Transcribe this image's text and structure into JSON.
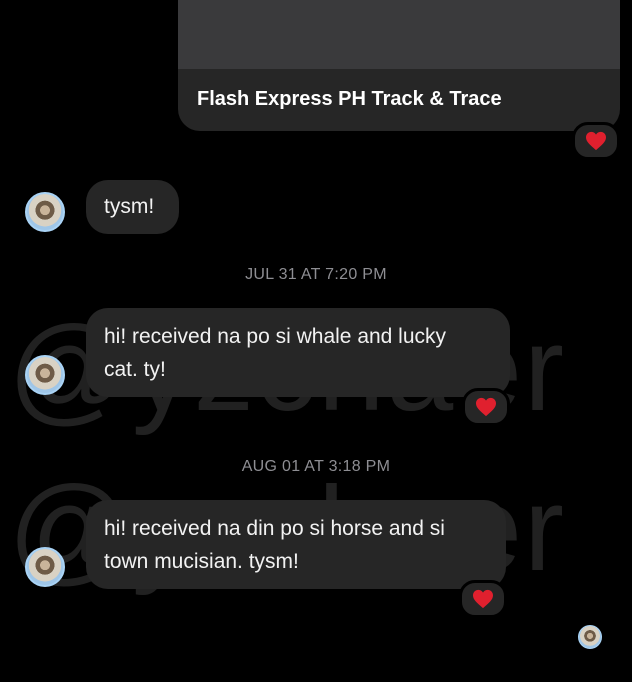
{
  "link_card": {
    "title": "Flash Express PH Track & Trace"
  },
  "reactions": {
    "emoji": "❤️",
    "color": "#e0202e"
  },
  "messages": [
    {
      "text": "tysm!"
    },
    {
      "timestamp": "JUL 31 AT 7:20 PM",
      "line1": "hi! received na po si whale and lucky",
      "line2": "cat. ty!"
    },
    {
      "timestamp": "AUG 01 AT 3:18 PM",
      "line1": "hi! received na din po si horse and si",
      "line2": "town mucisian. tysm!"
    }
  ],
  "watermark": "@yzchaer",
  "bubble_color": "#262626",
  "avatar_ring_color": "#a9d3f5"
}
